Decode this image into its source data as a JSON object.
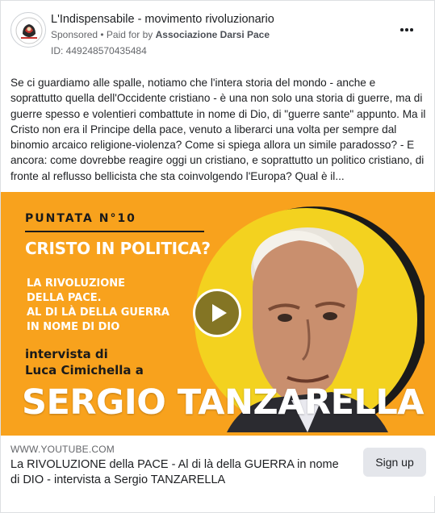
{
  "ad": {
    "page_name": "L'Indispensabile - movimento rivoluzionario",
    "sponsored_label": "Sponsored",
    "separator": " • ",
    "paid_for_prefix": "Paid for by ",
    "payer": "Associazione Darsi Pace",
    "id_label": "ID: 449248570435484",
    "more_icon": "more-horizontal-icon",
    "avatar_icon": "page-logo-icon"
  },
  "post": {
    "text": "Se ci guardiamo alle spalle, notiamo che l'intera storia del mondo - anche e soprattutto quella dell'Occidente cristiano - è una non solo una storia di guerre, ma di guerre spesso e volentieri combattute in nome di Dio, di \"guerre sante\" appunto. Ma il Cristo non era il Principe della pace, venuto a liberarci una volta per sempre dal binomio arcaico religione-violenza? Come si spiega allora un simile paradosso? - E ancora: come dovrebbe reagire oggi un cristiano, e soprattutto un politico cristiano, di fronte al reflusso bellicista che sta coinvolgendo l'Europa? Qual è il..."
  },
  "thumbnail": {
    "episode": "PUNTATA N°10",
    "headline": "CRISTO IN POLITICA?",
    "sub_lines": [
      "LA RIVOLUZIONE",
      "DELLA PACE.",
      "AL DI LÀ DELLA GUERRA",
      "IN NOME DI DIO"
    ],
    "interview_lines": [
      "intervista di",
      "Luca Cimichella a"
    ],
    "guest_name": "SERGIO TANZARELLA",
    "background_color": "#f8a21d",
    "play_icon": "play-icon"
  },
  "link": {
    "domain": "WWW.YOUTUBE.COM",
    "title": "La RIVOLUZIONE della PACE - Al di là della GUERRA in nome di DIO - intervista a Sergio TANZARELLA",
    "cta_label": "Sign up"
  }
}
